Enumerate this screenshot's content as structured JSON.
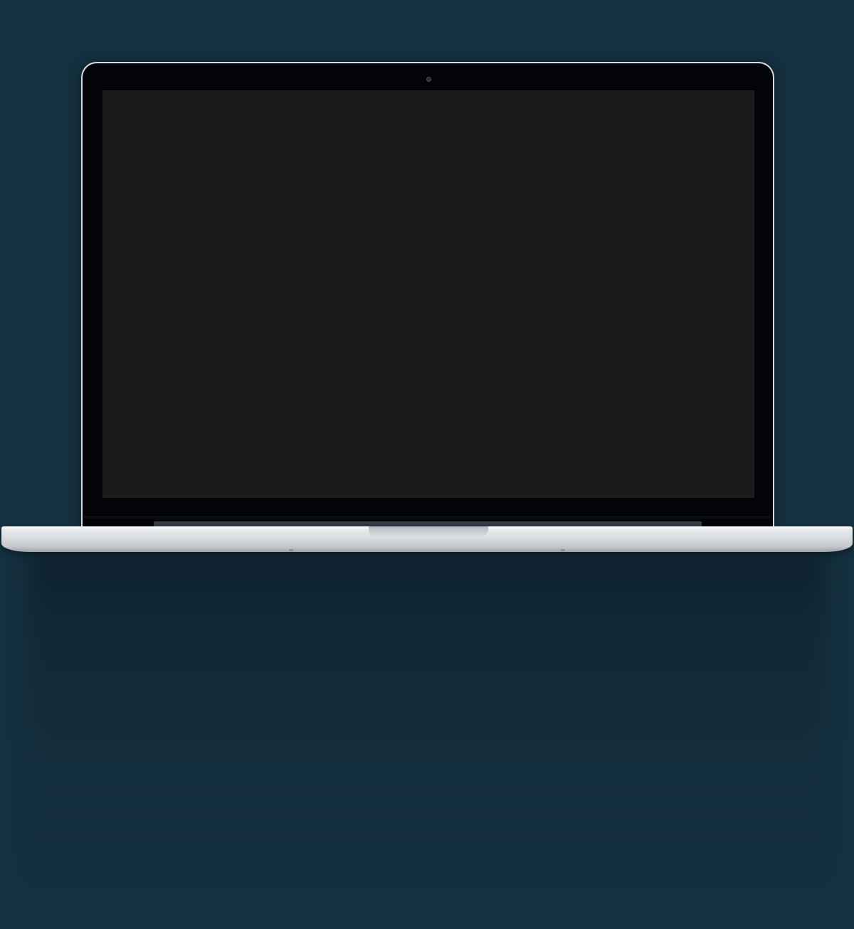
{
  "scene": {
    "description_type": "device-mockup",
    "device": "laptop",
    "screen_state": "blank",
    "colors": {
      "background": "#15303f",
      "bezel": "#030407",
      "screen": "#1b1b1b",
      "base_light": "#eef0f2",
      "base_dark": "#9fa4aa"
    },
    "icons": [
      "camera-icon"
    ]
  }
}
